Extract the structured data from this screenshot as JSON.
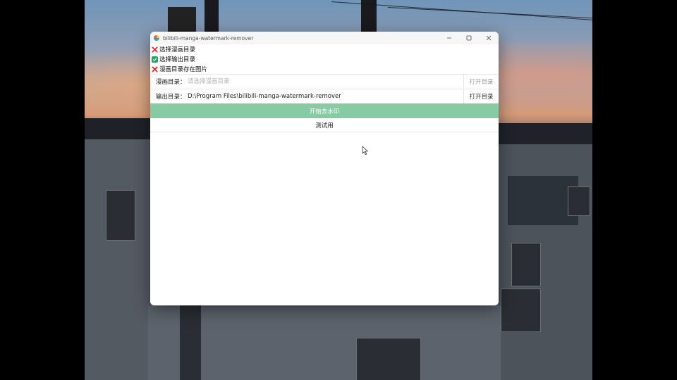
{
  "window": {
    "title": "bilibili-manga-watermark-remover",
    "controls": {
      "minimize_icon": "minimize-icon",
      "maximize_icon": "maximize-icon",
      "close_icon": "close-icon"
    }
  },
  "status": [
    {
      "label": "选择漫画目录",
      "ok": false
    },
    {
      "label": "选择输出目录",
      "ok": true
    },
    {
      "label": "漫画目录存在图片",
      "ok": false
    }
  ],
  "manga_dir": {
    "label": "漫画目录：",
    "value": "",
    "placeholder": "请选择漫画目录",
    "button": "打开目录"
  },
  "output_dir": {
    "label": "输出目录：",
    "value": "D:\\Program Files\\bilibili-manga-watermark-remover",
    "button": "打开目录"
  },
  "actions": {
    "start": "开始去水印",
    "test": "测试用"
  },
  "colors": {
    "accent_green": "#86cba3",
    "ok_green": "#22a565",
    "error_red": "#e0312f"
  }
}
